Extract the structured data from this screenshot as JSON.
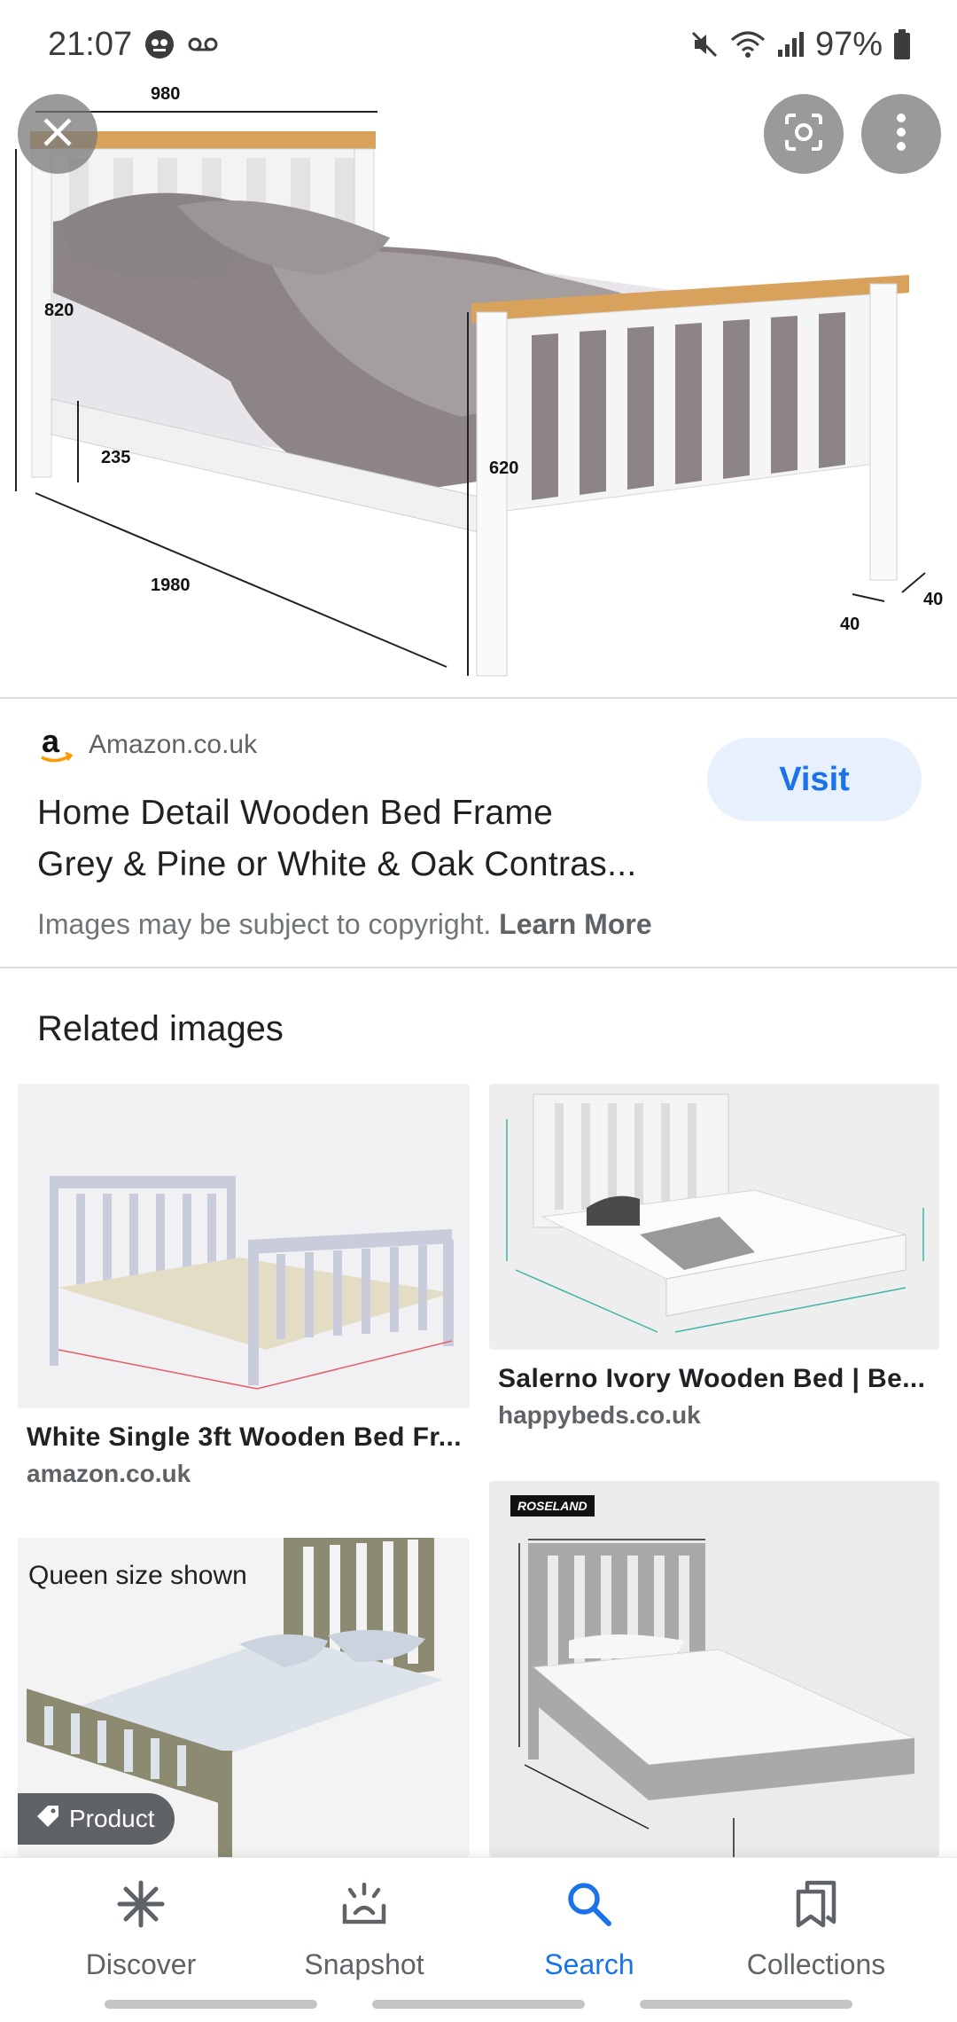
{
  "status_bar": {
    "time": "21:07",
    "battery": "97%"
  },
  "hero_image": {
    "dimensions": {
      "width_top": "980",
      "height_head": "820",
      "leg_clearance": "235",
      "length": "1980",
      "foot_height": "620",
      "leg_a": "40",
      "leg_b": "40"
    }
  },
  "result": {
    "source": "Amazon.co.uk",
    "title_line1": "Home Detail Wooden Bed Frame",
    "title_line2": "Grey & Pine or White & Oak Contras...",
    "visit_label": "Visit",
    "copyright_text": "Images may be subject to copyright.",
    "learn_more": "Learn More"
  },
  "related": {
    "heading": "Related images",
    "items": [
      {
        "title": "White Single 3ft Wooden Bed Fr...",
        "domain": "amazon.co.uk"
      },
      {
        "title": "Salerno Ivory Wooden Bed | Be...",
        "domain": "happybeds.co.uk"
      },
      {
        "overlay_text": "Queen size shown",
        "badge": "Product"
      },
      {
        "brand": "ROSELAND"
      }
    ]
  },
  "nav": {
    "items": [
      {
        "label": "Discover",
        "icon": "asterisk-icon"
      },
      {
        "label": "Snapshot",
        "icon": "snapshot-icon"
      },
      {
        "label": "Search",
        "icon": "search-icon",
        "active": true
      },
      {
        "label": "Collections",
        "icon": "bookmarks-icon"
      }
    ]
  },
  "colors": {
    "accent": "#1a73e8",
    "visit_bg": "#e8f0fe",
    "pine": "#d9a25c",
    "frame_white": "#fafafa",
    "duvet_grey": "#8d8585"
  }
}
